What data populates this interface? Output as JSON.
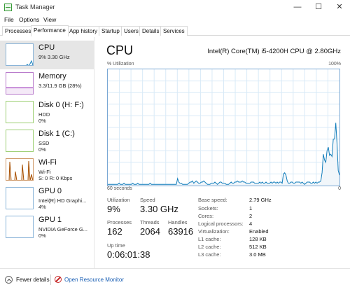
{
  "window": {
    "title": "Task Manager",
    "controls": {
      "minimize": "—",
      "maximize": "☐",
      "close": "✕"
    }
  },
  "menu": [
    "File",
    "Options",
    "View"
  ],
  "tabs": [
    "Processes",
    "Performance",
    "App history",
    "Startup",
    "Users",
    "Details",
    "Services"
  ],
  "active_tab": "Performance",
  "sidebar": [
    {
      "title": "CPU",
      "lines": [
        "9%  3.30 GHz"
      ],
      "color": "#117dbb",
      "selected": true
    },
    {
      "title": "Memory",
      "lines": [
        "3.3/11.9 GB (28%)"
      ],
      "color": "#8b12ae",
      "selected": false
    },
    {
      "title": "Disk 0 (H: F:)",
      "lines": [
        "HDD",
        "0%"
      ],
      "color": "#4da60c",
      "selected": false
    },
    {
      "title": "Disk 1 (C:)",
      "lines": [
        "SSD",
        "0%"
      ],
      "color": "#4da60c",
      "selected": false
    },
    {
      "title": "Wi-Fi",
      "lines": [
        "Wi-Fi",
        "S: 0  R: 0 Kbps"
      ],
      "color": "#a74f01",
      "selected": false
    },
    {
      "title": "GPU 0",
      "lines": [
        "Intel(R) HD Graphi...",
        "4%"
      ],
      "color": "#117dbb",
      "selected": false
    },
    {
      "title": "GPU 1",
      "lines": [
        "NVIDIA GeForce G...",
        "0%"
      ],
      "color": "#117dbb",
      "selected": false
    }
  ],
  "main": {
    "title": "CPU",
    "model": "Intel(R) Core(TM) i5-4200H CPU @ 2.80GHz",
    "util_label": "% Utilization",
    "util_max": "100%",
    "axis_left": "60 seconds",
    "axis_right": "0",
    "graph_color": "#117dbb",
    "graph_fill": "#f1f6fa",
    "utilization_history": [
      1,
      1,
      1,
      1,
      1,
      1,
      1,
      1,
      1,
      2,
      1,
      1,
      1,
      2,
      1,
      1,
      1,
      1,
      1,
      1,
      2,
      1,
      1,
      1,
      2,
      1,
      1,
      1,
      1,
      1,
      1,
      1,
      1,
      1,
      2,
      1,
      1,
      1,
      1,
      1,
      1,
      1,
      1,
      1,
      1,
      1,
      1,
      1,
      1,
      1,
      1,
      1,
      1,
      1,
      1,
      1,
      6,
      3,
      2,
      2,
      1,
      1,
      1,
      1,
      1,
      2,
      3,
      3,
      4,
      2,
      3,
      4,
      3,
      2,
      2,
      3,
      3,
      4,
      3,
      2,
      1,
      1,
      1,
      2,
      2,
      2,
      3,
      2,
      1,
      2,
      3,
      3,
      2,
      2,
      2,
      1,
      1,
      1,
      2,
      3,
      2,
      2,
      3,
      3,
      4,
      3,
      3,
      3,
      4,
      3,
      3,
      2,
      2,
      2,
      2,
      3,
      3,
      3,
      2,
      2,
      2,
      2,
      3,
      2,
      3,
      2,
      2,
      3,
      2,
      2,
      2,
      3,
      2,
      3,
      3,
      2,
      3,
      2,
      3,
      3,
      2,
      10,
      11,
      9,
      4,
      2,
      2,
      3,
      3,
      2,
      2,
      3,
      3,
      3,
      3,
      2,
      3,
      2,
      1,
      2,
      3,
      3,
      3,
      2,
      2,
      3,
      2,
      3,
      2,
      3,
      3,
      4,
      11,
      27,
      22,
      20,
      30,
      33,
      26,
      27,
      25,
      40,
      40,
      54,
      37,
      13,
      9
    ],
    "stats": {
      "utilization": {
        "label": "Utilization",
        "value": "9%"
      },
      "speed": {
        "label": "Speed",
        "value": "3.30 GHz"
      },
      "processes": {
        "label": "Processes",
        "value": "162"
      },
      "threads": {
        "label": "Threads",
        "value": "2064"
      },
      "handles": {
        "label": "Handles",
        "value": "63916"
      },
      "uptime": {
        "label": "Up time",
        "value": "0:06:01:38"
      }
    },
    "specs": [
      {
        "label": "Base speed:",
        "value": "2.79 GHz"
      },
      {
        "label": "Sockets:",
        "value": "1"
      },
      {
        "label": "Cores:",
        "value": "2"
      },
      {
        "label": "Logical processors:",
        "value": "4"
      },
      {
        "label": "Virtualization:",
        "value": "Enabled"
      },
      {
        "label": "L1 cache:",
        "value": "128 KB"
      },
      {
        "label": "L2 cache:",
        "value": "512 KB"
      },
      {
        "label": "L3 cache:",
        "value": "3.0 MB"
      }
    ]
  },
  "footer": {
    "fewer_details": "Fewer details",
    "open_resource_monitor": "Open Resource Monitor",
    "icons": [
      "chevron-up-icon",
      "resource-monitor-icon"
    ]
  }
}
